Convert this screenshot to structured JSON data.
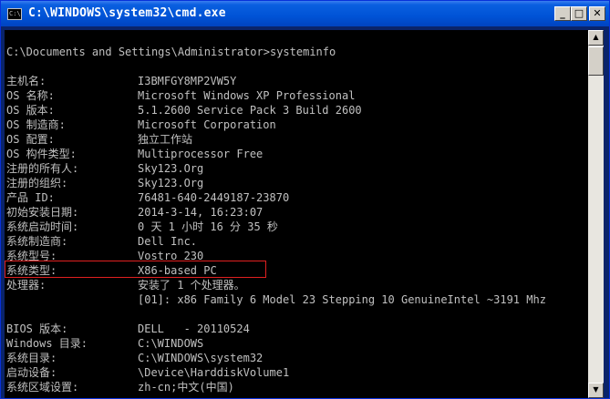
{
  "window": {
    "title": "C:\\WINDOWS\\system32\\cmd.exe",
    "icon_text": "C:\\",
    "minimize_glyph": "_",
    "maximize_glyph": "□",
    "close_glyph": "✕"
  },
  "console": {
    "prompt_line": "C:\\Documents and Settings\\Administrator>systeminfo",
    "rows": [
      {
        "key": "主机名:",
        "value": "I3BMFGY8MP2VW5Y"
      },
      {
        "key": "OS 名称:",
        "value": "Microsoft Windows XP Professional"
      },
      {
        "key": "OS 版本:",
        "value": "5.1.2600 Service Pack 3 Build 2600"
      },
      {
        "key": "OS 制造商:",
        "value": "Microsoft Corporation"
      },
      {
        "key": "OS 配置:",
        "value": "独立工作站"
      },
      {
        "key": "OS 构件类型:",
        "value": "Multiprocessor Free"
      },
      {
        "key": "注册的所有人:",
        "value": "Sky123.Org"
      },
      {
        "key": "注册的组织:",
        "value": "Sky123.Org"
      },
      {
        "key": "产品 ID:",
        "value": "76481-640-2449187-23870"
      },
      {
        "key": "初始安装日期:",
        "value": "2014-3-14, 16:23:07"
      },
      {
        "key": "系统启动时间:",
        "value": "0 天 1 小时 16 分 35 秒"
      },
      {
        "key": "系统制造商:",
        "value": "Dell Inc."
      },
      {
        "key": "系统型号:",
        "value": "Vostro 230"
      },
      {
        "key": "系统类型:",
        "value": "X86-based PC"
      },
      {
        "key": "处理器:",
        "value": "安装了 1 个处理器。"
      },
      {
        "key": "",
        "value": "[01]: x86 Family 6 Model 23 Stepping 10 GenuineIntel ~3191 Mhz"
      }
    ],
    "rows2": [
      {
        "key": "BIOS 版本:",
        "value": "DELL   - 20110524"
      },
      {
        "key": "Windows 目录:",
        "value": "C:\\WINDOWS"
      },
      {
        "key": "系统目录:",
        "value": "C:\\WINDOWS\\system32"
      },
      {
        "key": "启动设备:",
        "value": "\\Device\\HarddiskVolume1"
      },
      {
        "key": "系统区域设置:",
        "value": "zh-cn;中文(中国)"
      }
    ]
  },
  "scrollbar": {
    "up_glyph": "▲",
    "down_glyph": "▼"
  },
  "colors": {
    "console_bg": "#000000",
    "console_text": "#c0c0c0",
    "highlight_border": "#e02020",
    "titlebar": "#0053d6"
  }
}
